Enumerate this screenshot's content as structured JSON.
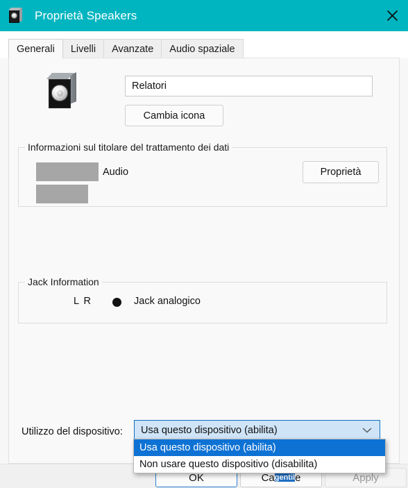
{
  "window": {
    "title": "Proprietà Speakers",
    "icon": "speaker-icon",
    "close_label": "✕",
    "accent_color": "#00b5c0"
  },
  "tabs": [
    {
      "label": "Generali",
      "active": true
    },
    {
      "label": "Livelli",
      "active": false
    },
    {
      "label": "Avanzate",
      "active": false
    },
    {
      "label": "Audio spaziale",
      "active": false
    }
  ],
  "general": {
    "device_icon": "speaker-icon",
    "name_value": "Relatori",
    "change_icon_label": "Cambia icona"
  },
  "controller_group": {
    "legend": "Informazioni sul titolare del trattamento dei dati",
    "audio_label": "Audio",
    "properties_label": "Proprietà",
    "redacted_rows": 2
  },
  "jack_group": {
    "legend": "Jack Information",
    "channels": "L R",
    "jack_label": "Jack analogico"
  },
  "device_usage": {
    "label": "Utilizzo del dispositivo:",
    "selected_value": "Usa questo dispositivo (abilita)",
    "chevron": "chevron-down-icon",
    "open": true,
    "options": [
      {
        "label": "Usa questo dispositivo (abilita)",
        "selected": true
      },
      {
        "label": "Non usare questo dispositivo (disabilita)",
        "selected": false
      }
    ],
    "selection_color": "#0e72d4"
  },
  "footer": {
    "ok_label": "OK",
    "cancel_label": "Cancel",
    "apply_label": "Apply",
    "apply_disabled": true,
    "cancel_overlay": {
      "prefix": "Ca",
      "highlighted": "gentil",
      "suffix": "e"
    }
  }
}
